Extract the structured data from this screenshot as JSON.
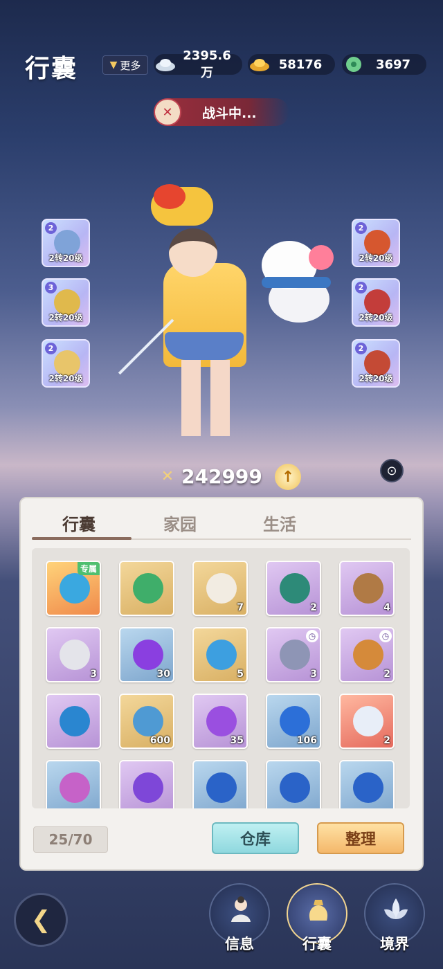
{
  "header": {
    "title": "行囊",
    "more_label": "更多",
    "currencies": [
      {
        "icon": "silver-ingot-icon",
        "value": "2395.6万"
      },
      {
        "icon": "gold-ingot-icon",
        "value": "58176"
      },
      {
        "icon": "jade-icon",
        "value": "3697"
      }
    ]
  },
  "battle_status": "战斗中...",
  "equipment": {
    "left": [
      {
        "level": "2",
        "label": "2转20级",
        "icon": "armor-icon",
        "color": "#7fa3d8"
      },
      {
        "level": "3",
        "label": "2转20级",
        "icon": "staff-icon",
        "color": "#e0b94c"
      },
      {
        "level": "2",
        "label": "2转20级",
        "icon": "ring-icon",
        "color": "#e8c56a"
      }
    ],
    "right": [
      {
        "level": "2",
        "label": "2转20级",
        "icon": "amulet-icon",
        "color": "#d6572f"
      },
      {
        "level": "2",
        "label": "2转20级",
        "icon": "helmet-icon",
        "color": "#c33d3a"
      },
      {
        "level": "2",
        "label": "2转20级",
        "icon": "bracer-icon",
        "color": "#c44a35"
      }
    ]
  },
  "power": "242999",
  "tabs": [
    "行囊",
    "家园",
    "生活"
  ],
  "items": [
    {
      "rarity": "orange",
      "tag": "专属",
      "count": "",
      "clock": false,
      "color": "#3aa8e0",
      "icon": "vase-icon"
    },
    {
      "rarity": "gold",
      "count": "",
      "clock": false,
      "color": "#3fae6a",
      "icon": "scroll-book-icon"
    },
    {
      "rarity": "gold",
      "count": "7",
      "clock": false,
      "color": "#f2ece2",
      "icon": "cup-icon"
    },
    {
      "rarity": "purple",
      "count": "2",
      "clock": false,
      "color": "#2d8a78",
      "icon": "peacock-statue-icon"
    },
    {
      "rarity": "purple",
      "count": "4",
      "clock": false,
      "color": "#b07a45",
      "icon": "bowl-icon"
    },
    {
      "rarity": "purple",
      "count": "3",
      "clock": false,
      "color": "#e4e4ea",
      "icon": "blade-icon"
    },
    {
      "rarity": "blue",
      "count": "30",
      "clock": false,
      "color": "#8a3fe0",
      "icon": "flame-icon"
    },
    {
      "rarity": "gold",
      "count": "5",
      "clock": false,
      "color": "#3d9fe0",
      "icon": "crystal-icon"
    },
    {
      "rarity": "purple",
      "count": "3",
      "clock": true,
      "color": "#8e95b5",
      "icon": "banana-icon"
    },
    {
      "rarity": "purple",
      "count": "2",
      "clock": true,
      "color": "#d58a3a",
      "icon": "berries-icon"
    },
    {
      "rarity": "purple",
      "count": "",
      "clock": false,
      "color": "#2a86d0",
      "icon": "magic-lamp-icon"
    },
    {
      "rarity": "gold",
      "count": "600",
      "clock": false,
      "color": "#4f9ad3",
      "icon": "training-book-icon"
    },
    {
      "rarity": "purple",
      "count": "35",
      "clock": false,
      "color": "#9a4fe0",
      "icon": "crystal-ball-icon"
    },
    {
      "rarity": "blue",
      "count": "106",
      "clock": false,
      "color": "#2c6fd8",
      "icon": "crystal-ball-icon"
    },
    {
      "rarity": "red",
      "count": "2",
      "clock": false,
      "color": "#e8eef8",
      "icon": "lotus-icon"
    },
    {
      "rarity": "blue",
      "count": "",
      "clock": false,
      "color": "#c662c8",
      "icon": "flower-icon"
    },
    {
      "rarity": "purple",
      "count": "",
      "clock": false,
      "color": "#7e47d8",
      "icon": "crystal-ball-icon"
    },
    {
      "rarity": "blue",
      "count": "",
      "clock": false,
      "color": "#2a63c8",
      "icon": "crystal-ball-icon"
    },
    {
      "rarity": "blue",
      "count": "",
      "clock": false,
      "color": "#2a63c8",
      "icon": "crystal-ball-icon"
    },
    {
      "rarity": "blue",
      "count": "",
      "clock": false,
      "color": "#2a63c8",
      "icon": "crystal-ball-icon"
    }
  ],
  "capacity": "25/70",
  "warehouse_label": "仓库",
  "sort_label": "整理",
  "nav": [
    {
      "label": "信息",
      "icon": "character-icon",
      "active": false
    },
    {
      "label": "行囊",
      "icon": "bag-icon",
      "active": true
    },
    {
      "label": "境界",
      "icon": "lotus-icon",
      "active": false
    }
  ]
}
